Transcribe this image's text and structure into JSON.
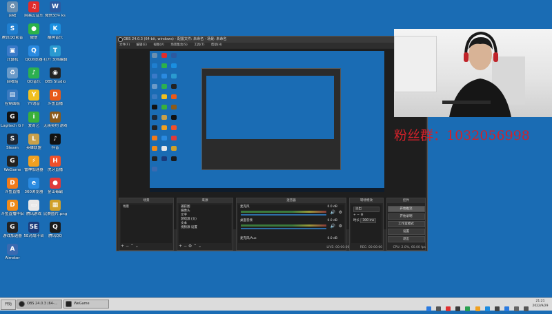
{
  "desktop": {
    "icons": [
      {
        "label": "回收",
        "color": "#6a8fb0",
        "glyph": "♻"
      },
      {
        "label": "网易云音乐",
        "color": "#e02c2c",
        "glyph": "♫"
      },
      {
        "label": "微信文件 ks",
        "color": "#2c5aa0",
        "glyph": "W"
      },
      {
        "label": "腾讯QQ影音",
        "color": "#1f7fd0",
        "glyph": "S"
      },
      {
        "label": "微信",
        "color": "#2cb24a",
        "glyph": "●"
      },
      {
        "label": "酷狗音乐",
        "color": "#1a8fe0",
        "glyph": "K"
      },
      {
        "label": "计算机",
        "color": "#3a7ac8",
        "glyph": "▣"
      },
      {
        "label": "QQ浏览器",
        "color": "#2a8ae0",
        "glyph": "Q"
      },
      {
        "label": "打开 文档编辑器",
        "color": "#2a9ad0",
        "glyph": "T"
      },
      {
        "label": "回收站",
        "color": "#6a9ac8",
        "glyph": "♻"
      },
      {
        "label": "QQ音乐",
        "color": "#2cb050",
        "glyph": "♪"
      },
      {
        "label": "OBS Studio",
        "color": "#222222",
        "glyph": "◉"
      },
      {
        "label": "控制面板",
        "color": "#3a7ac0",
        "glyph": "▤"
      },
      {
        "label": "YY语音",
        "color": "#f0c020",
        "glyph": "Y"
      },
      {
        "label": "斗鱼直播",
        "color": "#e85a1a",
        "glyph": "D"
      },
      {
        "label": "Logitech G HUB",
        "color": "#111111",
        "glyph": "G"
      },
      {
        "label": "爱奇艺",
        "color": "#3ab03a",
        "glyph": "i"
      },
      {
        "label": "无畏契约 游戏平台",
        "color": "#8a5a1a",
        "glyph": "W"
      },
      {
        "label": "Steam",
        "color": "#1b2838",
        "glyph": "S"
      },
      {
        "label": "英雄联盟",
        "color": "#c8a04a",
        "glyph": "L"
      },
      {
        "label": "抖音",
        "color": "#111111",
        "glyph": "♪"
      },
      {
        "label": "WeGame",
        "color": "#222222",
        "glyph": "G"
      },
      {
        "label": "雷神加速器",
        "color": "#f0a020",
        "glyph": "⚡"
      },
      {
        "label": "虎牙直播",
        "color": "#f0502a",
        "glyph": "H"
      },
      {
        "label": "斗鱼直播",
        "color": "#f07a1a",
        "glyph": "D"
      },
      {
        "label": "360浏览器",
        "color": "#2a8ae0",
        "glyph": "e"
      },
      {
        "label": "金山毒霸",
        "color": "#e03a3a",
        "glyph": "●"
      },
      {
        "label": "斗鱼直播伴侣",
        "color": "#f08a1a",
        "glyph": "D"
      },
      {
        "label": "腾讯游戏",
        "color": "#e8e8e8",
        "glyph": "▭"
      },
      {
        "label": "比赛图片.png",
        "color": "#d0a02a",
        "glyph": "▦"
      },
      {
        "label": "游戏加速器",
        "color": "#222222",
        "glyph": "G"
      },
      {
        "label": "5E对战平台",
        "color": "#1a3a7a",
        "glyph": "5E"
      },
      {
        "label": "腾讯QQ",
        "color": "#1a1a1a",
        "glyph": "Q"
      },
      {
        "label": "Aimster",
        "color": "#3a6ab0",
        "glyph": "A"
      }
    ]
  },
  "obs": {
    "title": "OBS 24.0.3 (64-bit, windows) - 配置文件: 未命名 - 场景: 未命名",
    "menu": [
      "文件(F)",
      "编辑(E)",
      "视图(V)",
      "场景集合(S)",
      "工具(T)",
      "帮助(H)"
    ],
    "docks": {
      "scenes": {
        "title": "场景",
        "items": [
          "场景"
        ]
      },
      "sources": {
        "title": "来源",
        "items": [
          "捕获图",
          "摄像头",
          "文字",
          "游戏源 (文)",
          "文本",
          "视频源 设置"
        ]
      },
      "mixer": {
        "title": "混音器",
        "channels": [
          {
            "name": "麦克风",
            "db": "0.0 dB"
          },
          {
            "name": "桌面音频",
            "db": "0.0 dB"
          }
        ],
        "foot": "麦克风/Aux",
        "foot_db": "0.0 dB"
      },
      "transitions": {
        "title": "转场特效",
        "type": "淡出",
        "duration_label": "时长",
        "duration": "300 ms"
      },
      "controls": {
        "title": "控件",
        "buttons": [
          "开始推流",
          "开始录制",
          "工作室模式",
          "设置",
          "退出"
        ]
      }
    },
    "status": {
      "live": "LIVE: 00:00:00",
      "rec": "REC: 00:00:00",
      "cpu": "CPU: 2.0%, 60.00 fps"
    }
  },
  "overlay": {
    "fans_text": "粉丝群：1032056998"
  },
  "taskbar": {
    "start_label": "开始",
    "tasks": [
      {
        "label": "OBS 24.0.3 (64-...",
        "active": true
      },
      {
        "label": "WeGame",
        "active": false
      }
    ],
    "clock_time": "21:21",
    "clock_date": "2022/9/29"
  }
}
